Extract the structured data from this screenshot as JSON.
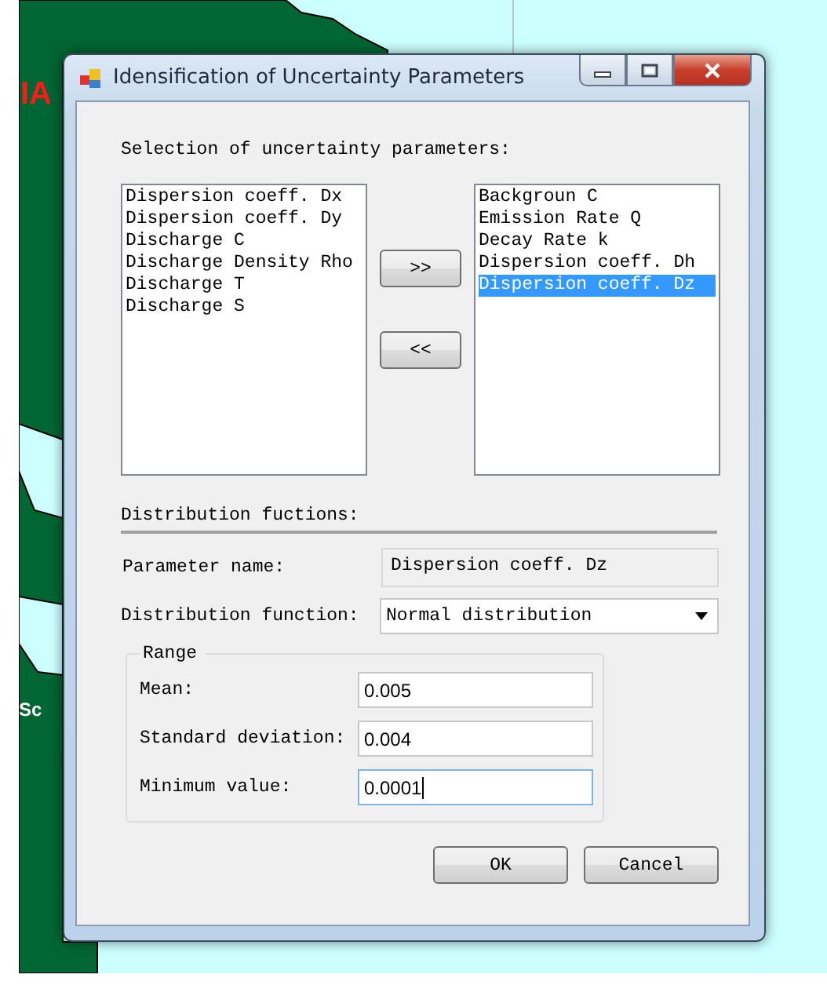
{
  "map": {
    "labels": [
      {
        "text": "IA",
        "kind": "red"
      },
      {
        "text": "Sc",
        "kind": "white"
      }
    ]
  },
  "window": {
    "title": "Idensification of Uncertainty Parameters"
  },
  "selection": {
    "label": "Selection of uncertainty parameters:",
    "available": [
      {
        "label": "Dispersion coeff. Dx",
        "selected": false
      },
      {
        "label": "Dispersion coeff. Dy",
        "selected": false
      },
      {
        "label": "Discharge C",
        "selected": false
      },
      {
        "label": "Discharge Density Rho",
        "selected": false
      },
      {
        "label": "Discharge T",
        "selected": false
      },
      {
        "label": "Discharge S",
        "selected": false
      }
    ],
    "add_button": ">>",
    "remove_button": "<<",
    "chosen": [
      {
        "label": "Backgroun C",
        "selected": false
      },
      {
        "label": "Emission Rate Q",
        "selected": false
      },
      {
        "label": "Decay Rate k",
        "selected": false
      },
      {
        "label": "Dispersion coeff. Dh",
        "selected": false
      },
      {
        "label": "Dispersion coeff. Dz",
        "selected": true
      }
    ]
  },
  "distribution": {
    "heading": "Distribution fuctions:",
    "parameter_label": "Parameter name:",
    "parameter_value": "Dispersion coeff. Dz",
    "function_label": "Distribution function:",
    "function_value": "Normal distribution",
    "range": {
      "title": "Range",
      "fields": [
        {
          "label": "Mean:",
          "value": "0.005",
          "focused": false
        },
        {
          "label": "Standard deviation:",
          "value": "0.004",
          "focused": false
        },
        {
          "label": "Minimum value:",
          "value": "0.0001",
          "focused": true
        }
      ]
    }
  },
  "buttons": [
    "OK",
    "Cancel"
  ]
}
